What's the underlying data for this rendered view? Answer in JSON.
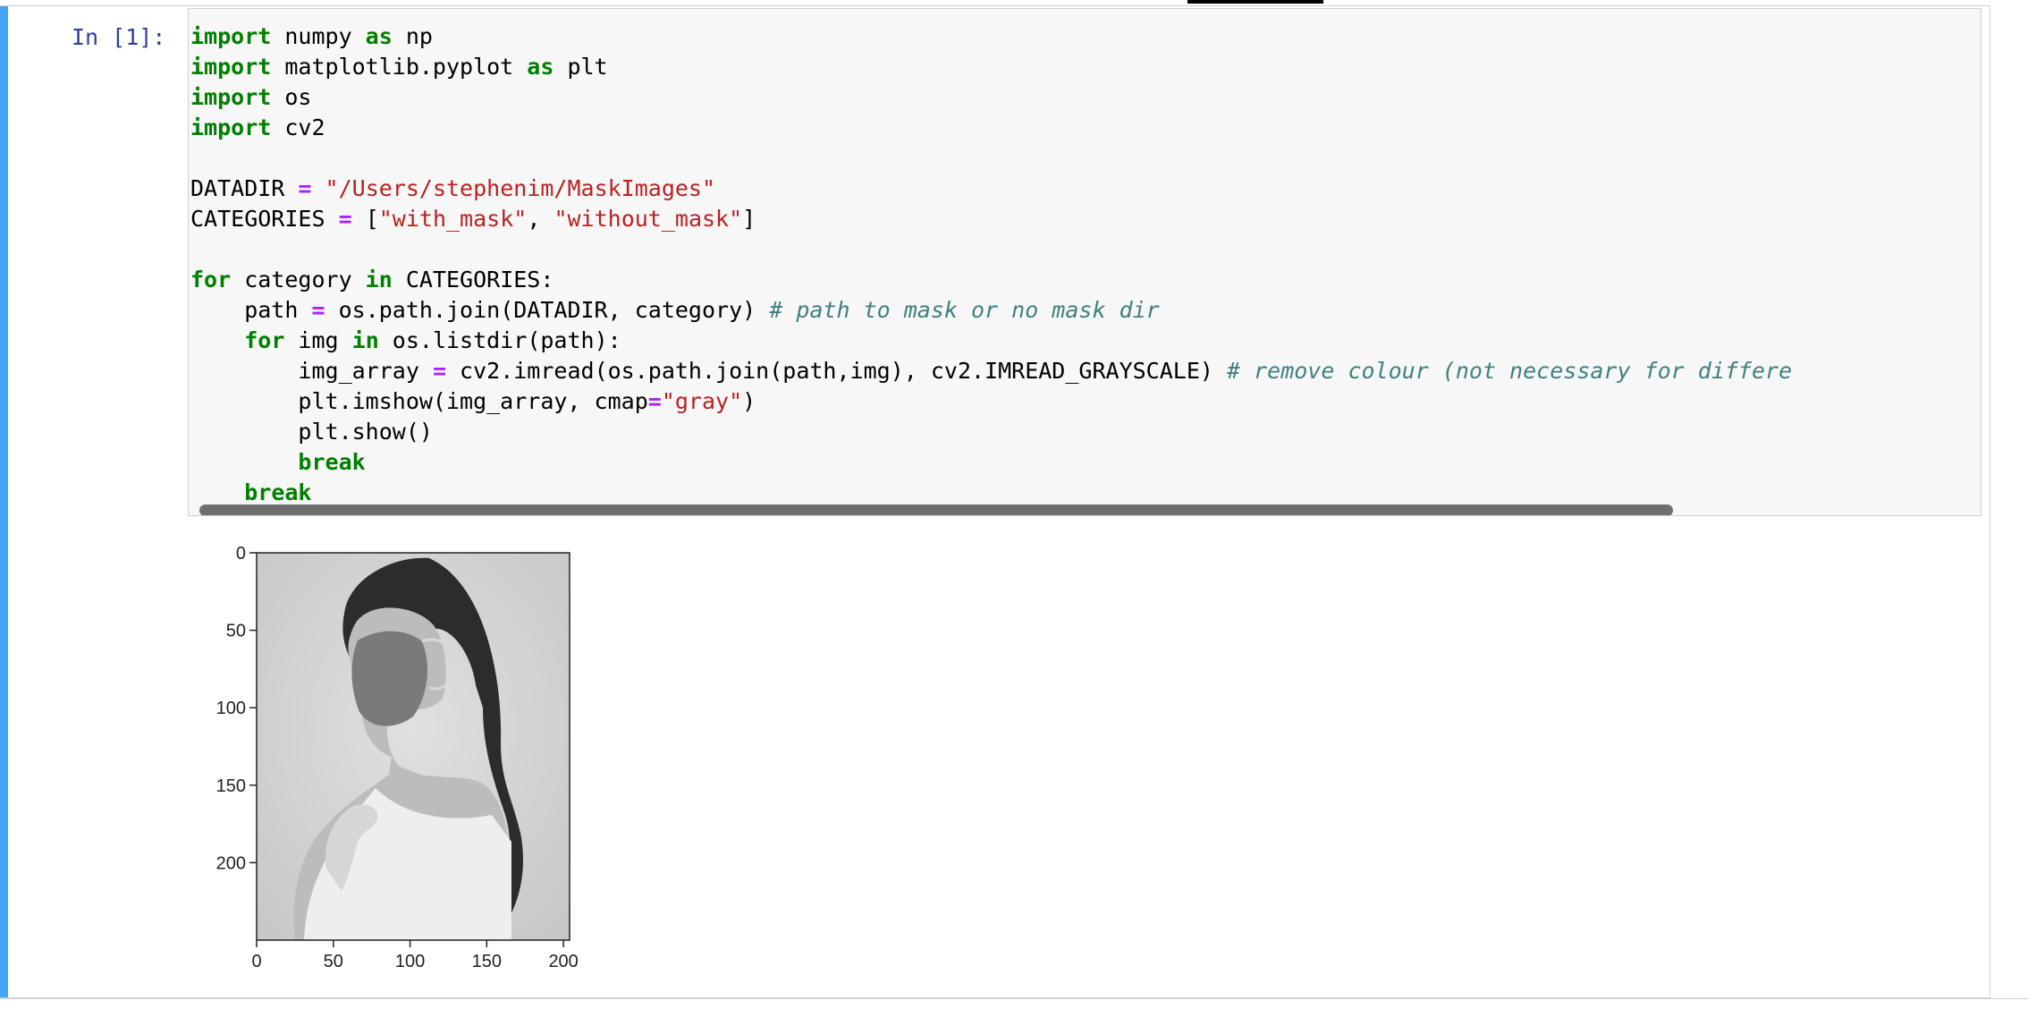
{
  "cell": {
    "prompt": "In [1]:",
    "code_lines": [
      [
        {
          "t": "import",
          "c": "kw"
        },
        {
          "t": " numpy ",
          "c": ""
        },
        {
          "t": "as",
          "c": "kw"
        },
        {
          "t": " np",
          "c": ""
        }
      ],
      [
        {
          "t": "import",
          "c": "kw"
        },
        {
          "t": " matplotlib.pyplot ",
          "c": ""
        },
        {
          "t": "as",
          "c": "kw"
        },
        {
          "t": " plt",
          "c": ""
        }
      ],
      [
        {
          "t": "import",
          "c": "kw"
        },
        {
          "t": " os",
          "c": ""
        }
      ],
      [
        {
          "t": "import",
          "c": "kw"
        },
        {
          "t": " cv2",
          "c": ""
        }
      ],
      [],
      [
        {
          "t": "DATADIR ",
          "c": ""
        },
        {
          "t": "=",
          "c": "op"
        },
        {
          "t": " ",
          "c": ""
        },
        {
          "t": "\"/Users/stephenim/MaskImages\"",
          "c": "str"
        }
      ],
      [
        {
          "t": "CATEGORIES ",
          "c": ""
        },
        {
          "t": "=",
          "c": "op"
        },
        {
          "t": " [",
          "c": ""
        },
        {
          "t": "\"with_mask\"",
          "c": "str"
        },
        {
          "t": ", ",
          "c": ""
        },
        {
          "t": "\"without_mask\"",
          "c": "str"
        },
        {
          "t": "]",
          "c": ""
        }
      ],
      [],
      [
        {
          "t": "for",
          "c": "kw"
        },
        {
          "t": " category ",
          "c": ""
        },
        {
          "t": "in",
          "c": "kw"
        },
        {
          "t": " CATEGORIES:",
          "c": ""
        }
      ],
      [
        {
          "t": "    path ",
          "c": ""
        },
        {
          "t": "=",
          "c": "op"
        },
        {
          "t": " os.path.join(DATADIR, category) ",
          "c": ""
        },
        {
          "t": "# path to mask or no mask dir",
          "c": "cm"
        }
      ],
      [
        {
          "t": "    ",
          "c": ""
        },
        {
          "t": "for",
          "c": "kw"
        },
        {
          "t": " img ",
          "c": ""
        },
        {
          "t": "in",
          "c": "kw"
        },
        {
          "t": " os.listdir(path):",
          "c": ""
        }
      ],
      [
        {
          "t": "        img_array ",
          "c": ""
        },
        {
          "t": "=",
          "c": "op"
        },
        {
          "t": " cv2.imread(os.path.join(path,img), cv2.IMREAD_GRAYSCALE) ",
          "c": ""
        },
        {
          "t": "# remove colour (not necessary for differe",
          "c": "cm"
        }
      ],
      [
        {
          "t": "        plt.imshow(img_array, cmap",
          "c": ""
        },
        {
          "t": "=",
          "c": "op"
        },
        {
          "t": "\"gray\"",
          "c": "str"
        },
        {
          "t": ")",
          "c": ""
        }
      ],
      [
        {
          "t": "        plt.show()",
          "c": ""
        }
      ],
      [
        {
          "t": "        ",
          "c": ""
        },
        {
          "t": "break",
          "c": "kw"
        }
      ],
      [
        {
          "t": "    ",
          "c": ""
        },
        {
          "t": "break",
          "c": "kw"
        }
      ]
    ]
  },
  "output_plot": {
    "x_ticks": [
      "0",
      "50",
      "100",
      "150",
      "200"
    ],
    "y_ticks": [
      "0",
      "50",
      "100",
      "150",
      "200"
    ],
    "image": "grayscale-photo-woman-wearing-face-mask"
  },
  "colors": {
    "sidebar": "#42a5f5",
    "prompt": "#303f9f",
    "keyword": "#008000",
    "operator": "#aa22ff",
    "string": "#ba2121",
    "comment": "#408080"
  }
}
